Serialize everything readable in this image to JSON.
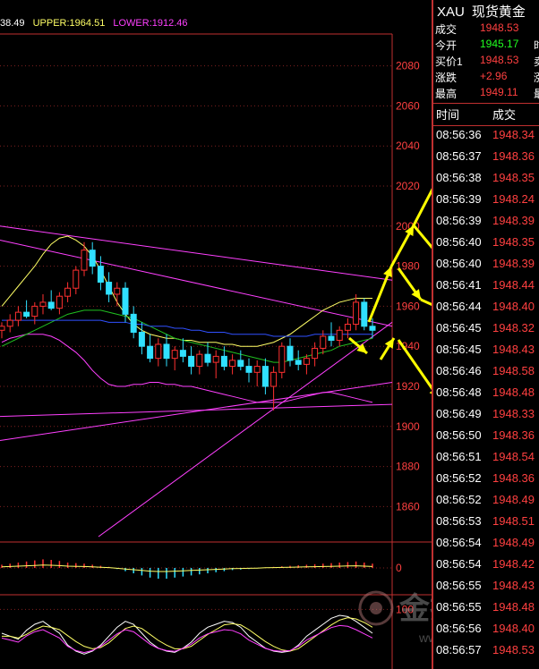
{
  "legend": {
    "mid": "38.49",
    "upper": "UPPER:1964.51",
    "lower": "LOWER:1912.46"
  },
  "colors": {
    "up": "#ff3030",
    "down": "#30e0ff",
    "upper_band": "#ffff66",
    "lower_band": "#ff40ff",
    "ma_green": "#20c020",
    "ma_blue": "#3050ff",
    "trend": "#ff40ff",
    "arrows": "#ffff00"
  },
  "quote": {
    "symbol": "XAU",
    "name": "现货黄金",
    "rows": [
      {
        "label": "成交",
        "value": "1948.53",
        "extra": ""
      },
      {
        "label": "今开",
        "value": "1945.17",
        "extra": "时"
      },
      {
        "label": "买价1",
        "value": "1948.53",
        "extra": "卖"
      },
      {
        "label": "涨跌",
        "value": "+2.96",
        "extra": "涨"
      },
      {
        "label": "最高",
        "value": "1949.11",
        "extra": "最"
      }
    ]
  },
  "ticks": {
    "header_time": "时间",
    "header_price": "成交",
    "rows": [
      {
        "time": "08:56:36",
        "price": "1948.34"
      },
      {
        "time": "08:56:37",
        "price": "1948.36"
      },
      {
        "time": "08:56:38",
        "price": "1948.35"
      },
      {
        "time": "08:56:39",
        "price": "1948.24"
      },
      {
        "time": "08:56:39",
        "price": "1948.39"
      },
      {
        "time": "08:56:40",
        "price": "1948.35"
      },
      {
        "time": "08:56:40",
        "price": "1948.39"
      },
      {
        "time": "08:56:41",
        "price": "1948.44"
      },
      {
        "time": "08:56:44",
        "price": "1948.40"
      },
      {
        "time": "08:56:45",
        "price": "1948.32"
      },
      {
        "time": "08:56:45",
        "price": "1948.43"
      },
      {
        "time": "08:56:46",
        "price": "1948.58"
      },
      {
        "time": "08:56:48",
        "price": "1948.48"
      },
      {
        "time": "08:56:49",
        "price": "1948.33"
      },
      {
        "time": "08:56:50",
        "price": "1948.36"
      },
      {
        "time": "08:56:51",
        "price": "1948.54"
      },
      {
        "time": "08:56:52",
        "price": "1948.36"
      },
      {
        "time": "08:56:52",
        "price": "1948.49"
      },
      {
        "time": "08:56:53",
        "price": "1948.51"
      },
      {
        "time": "08:56:54",
        "price": "1948.49"
      },
      {
        "time": "08:56:54",
        "price": "1948.42"
      },
      {
        "time": "08:56:55",
        "price": "1948.43"
      },
      {
        "time": "08:56:55",
        "price": "1948.48"
      },
      {
        "time": "08:56:56",
        "price": "1948.40"
      },
      {
        "time": "08:56:57",
        "price": "1948.53"
      }
    ]
  },
  "watermark": {
    "text": "金投网",
    "url": "www.jrwck.com"
  },
  "chart_data": [
    {
      "type": "candlestick",
      "title": "",
      "ylim": [
        1845,
        2095
      ],
      "yticks": [
        1860,
        1880,
        1900,
        1920,
        1940,
        1960,
        1980,
        2000,
        2020,
        2040,
        2060,
        2080
      ],
      "grid": true,
      "candles": [
        {
          "o": 1948,
          "h": 1952,
          "l": 1944,
          "c": 1950
        },
        {
          "o": 1950,
          "h": 1956,
          "l": 1947,
          "c": 1953
        },
        {
          "o": 1953,
          "h": 1960,
          "l": 1950,
          "c": 1957
        },
        {
          "o": 1957,
          "h": 1963,
          "l": 1954,
          "c": 1955
        },
        {
          "o": 1955,
          "h": 1962,
          "l": 1951,
          "c": 1960
        },
        {
          "o": 1960,
          "h": 1966,
          "l": 1956,
          "c": 1962
        },
        {
          "o": 1962,
          "h": 1968,
          "l": 1958,
          "c": 1959
        },
        {
          "o": 1959,
          "h": 1967,
          "l": 1956,
          "c": 1965
        },
        {
          "o": 1965,
          "h": 1972,
          "l": 1962,
          "c": 1969
        },
        {
          "o": 1969,
          "h": 1980,
          "l": 1966,
          "c": 1978
        },
        {
          "o": 1978,
          "h": 1992,
          "l": 1975,
          "c": 1988
        },
        {
          "o": 1988,
          "h": 1992,
          "l": 1976,
          "c": 1980
        },
        {
          "o": 1980,
          "h": 1985,
          "l": 1968,
          "c": 1972
        },
        {
          "o": 1972,
          "h": 1977,
          "l": 1962,
          "c": 1966
        },
        {
          "o": 1966,
          "h": 1972,
          "l": 1960,
          "c": 1969
        },
        {
          "o": 1969,
          "h": 1972,
          "l": 1952,
          "c": 1956
        },
        {
          "o": 1956,
          "h": 1960,
          "l": 1944,
          "c": 1947
        },
        {
          "o": 1947,
          "h": 1952,
          "l": 1936,
          "c": 1940
        },
        {
          "o": 1940,
          "h": 1946,
          "l": 1932,
          "c": 1934
        },
        {
          "o": 1934,
          "h": 1944,
          "l": 1930,
          "c": 1941
        },
        {
          "o": 1941,
          "h": 1946,
          "l": 1930,
          "c": 1934
        },
        {
          "o": 1934,
          "h": 1940,
          "l": 1928,
          "c": 1938
        },
        {
          "o": 1938,
          "h": 1944,
          "l": 1932,
          "c": 1935
        },
        {
          "o": 1935,
          "h": 1940,
          "l": 1926,
          "c": 1930
        },
        {
          "o": 1930,
          "h": 1938,
          "l": 1926,
          "c": 1936
        },
        {
          "o": 1936,
          "h": 1942,
          "l": 1930,
          "c": 1932
        },
        {
          "o": 1932,
          "h": 1938,
          "l": 1924,
          "c": 1935
        },
        {
          "o": 1935,
          "h": 1940,
          "l": 1928,
          "c": 1930
        },
        {
          "o": 1930,
          "h": 1936,
          "l": 1926,
          "c": 1933
        },
        {
          "o": 1933,
          "h": 1938,
          "l": 1928,
          "c": 1930
        },
        {
          "o": 1930,
          "h": 1934,
          "l": 1922,
          "c": 1927
        },
        {
          "o": 1927,
          "h": 1933,
          "l": 1920,
          "c": 1930
        },
        {
          "o": 1930,
          "h": 1934,
          "l": 1916,
          "c": 1920
        },
        {
          "o": 1920,
          "h": 1930,
          "l": 1908,
          "c": 1927
        },
        {
          "o": 1927,
          "h": 1942,
          "l": 1924,
          "c": 1940
        },
        {
          "o": 1940,
          "h": 1944,
          "l": 1930,
          "c": 1933
        },
        {
          "o": 1933,
          "h": 1938,
          "l": 1928,
          "c": 1931
        },
        {
          "o": 1931,
          "h": 1936,
          "l": 1926,
          "c": 1934
        },
        {
          "o": 1934,
          "h": 1942,
          "l": 1930,
          "c": 1939
        },
        {
          "o": 1939,
          "h": 1948,
          "l": 1936,
          "c": 1945
        },
        {
          "o": 1945,
          "h": 1952,
          "l": 1940,
          "c": 1943
        },
        {
          "o": 1943,
          "h": 1950,
          "l": 1940,
          "c": 1948
        },
        {
          "o": 1948,
          "h": 1954,
          "l": 1944,
          "c": 1951
        },
        {
          "o": 1951,
          "h": 1966,
          "l": 1948,
          "c": 1962
        },
        {
          "o": 1962,
          "h": 1964,
          "l": 1948,
          "c": 1950
        },
        {
          "o": 1950,
          "h": 1954,
          "l": 1944,
          "c": 1948
        }
      ],
      "series": [
        {
          "name": "UPPER",
          "values": [
            1960,
            1965,
            1970,
            1975,
            1980,
            1986,
            1991,
            1994,
            1995,
            1993,
            1990,
            1985,
            1978,
            1970,
            1962,
            1956,
            1951,
            1948,
            1946,
            1945,
            1944,
            1944,
            1943,
            1943,
            1942,
            1942,
            1942,
            1941,
            1941,
            1940,
            1940,
            1940,
            1941,
            1942,
            1944,
            1946,
            1949,
            1952,
            1955,
            1958,
            1960,
            1962,
            1963,
            1964,
            1964,
            1964
          ]
        },
        {
          "name": "LOWER",
          "values": [
            1942,
            1944,
            1945,
            1946,
            1946,
            1946,
            1945,
            1943,
            1940,
            1937,
            1933,
            1928,
            1924,
            1921,
            1920,
            1920,
            1921,
            1921,
            1922,
            1922,
            1921,
            1921,
            1920,
            1920,
            1919,
            1918,
            1917,
            1916,
            1915,
            1914,
            1913,
            1912,
            1912,
            1912,
            1912,
            1913,
            1914,
            1915,
            1916,
            1917,
            1917,
            1916,
            1915,
            1914,
            1913,
            1912
          ]
        },
        {
          "name": "MA_GREEN",
          "values": [
            1940,
            1942,
            1944,
            1946,
            1948,
            1950,
            1952,
            1954,
            1956,
            1957,
            1958,
            1958,
            1958,
            1957,
            1956,
            1955,
            1954,
            1952,
            1950,
            1948,
            1946,
            1944,
            1943,
            1942,
            1941,
            1940,
            1939,
            1938,
            1937,
            1936,
            1935,
            1934,
            1933,
            1932,
            1932,
            1933,
            1934,
            1935,
            1936,
            1937,
            1938,
            1940,
            1941,
            1942,
            1943,
            1944
          ]
        },
        {
          "name": "MA_BLUE",
          "values": [
            1953,
            1953,
            1953,
            1953,
            1953,
            1953,
            1953,
            1953,
            1953,
            1953,
            1953,
            1953,
            1953,
            1952,
            1952,
            1952,
            1951,
            1951,
            1950,
            1950,
            1950,
            1949,
            1949,
            1948,
            1948,
            1947,
            1947,
            1947,
            1946,
            1946,
            1946,
            1946,
            1946,
            1945,
            1945,
            1945,
            1945,
            1945,
            1946,
            1946,
            1946,
            1946,
            1946,
            1946,
            1946,
            1946
          ]
        }
      ]
    },
    {
      "type": "bar",
      "title": "",
      "yticks": [
        0
      ],
      "ylim": [
        -3,
        3
      ],
      "values": [
        0.6,
        0.8,
        1.0,
        1.2,
        1.4,
        1.6,
        1.5,
        1.3,
        1.0,
        0.9,
        0.8,
        0.6,
        0.4,
        0.2,
        -0.2,
        -0.6,
        -1.0,
        -1.4,
        -1.8,
        -2.0,
        -2.0,
        -1.8,
        -1.6,
        -1.4,
        -1.2,
        -1.0,
        -0.8,
        -0.6,
        -0.4,
        -0.3,
        -0.2,
        -0.1,
        0.1,
        0.2,
        0.3,
        0.4,
        0.5,
        0.6,
        0.7,
        0.8,
        0.9,
        1.0,
        1.1,
        1.2,
        1.0,
        0.8
      ]
    },
    {
      "type": "line",
      "title": "",
      "yticks": [
        100
      ],
      "ylim": [
        0,
        120
      ],
      "series": [
        {
          "name": "K",
          "values": [
            60,
            55,
            50,
            65,
            75,
            80,
            70,
            60,
            40,
            30,
            25,
            30,
            40,
            55,
            70,
            80,
            75,
            60,
            45,
            35,
            30,
            28,
            35,
            45,
            60,
            70,
            75,
            80,
            78,
            70,
            55,
            45,
            35,
            30,
            28,
            30,
            40,
            55,
            65,
            75,
            85,
            90,
            88,
            80,
            70,
            60
          ]
        },
        {
          "name": "D",
          "values": [
            55,
            55,
            52,
            58,
            66,
            72,
            70,
            66,
            56,
            46,
            38,
            34,
            36,
            44,
            56,
            68,
            72,
            68,
            58,
            48,
            40,
            34,
            34,
            38,
            48,
            58,
            66,
            74,
            76,
            74,
            66,
            56,
            46,
            38,
            32,
            30,
            34,
            44,
            54,
            64,
            74,
            82,
            86,
            84,
            78,
            70
          ]
        }
      ]
    }
  ]
}
